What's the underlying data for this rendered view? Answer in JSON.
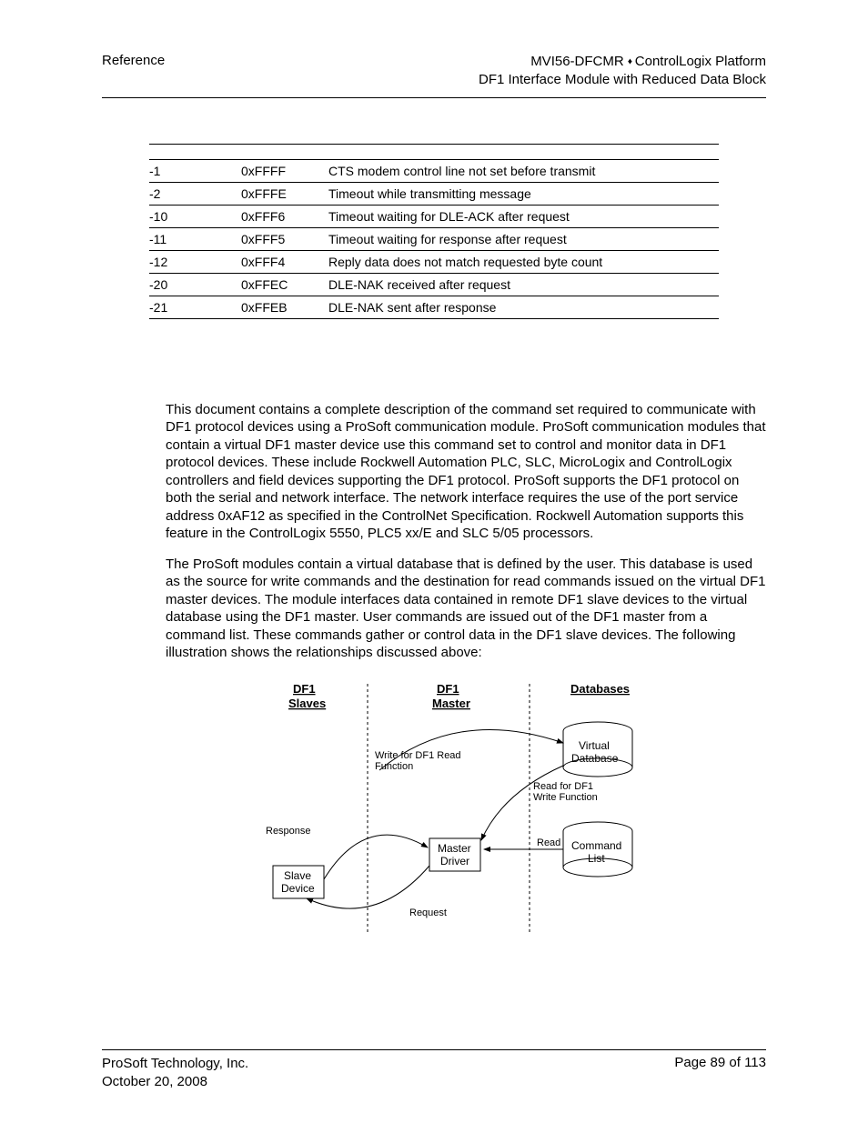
{
  "header": {
    "left": "Reference",
    "right_line1_a": "MVI56-DFCMR",
    "right_line1_b": "ControlLogix Platform",
    "right_line2": "DF1 Interface Module with Reduced Data Block"
  },
  "error_table": [
    {
      "dec": "-1",
      "hex": "0xFFFF",
      "desc": "CTS modem control line not set before transmit"
    },
    {
      "dec": "-2",
      "hex": "0xFFFE",
      "desc": "Timeout while transmitting message"
    },
    {
      "dec": "-10",
      "hex": "0xFFF6",
      "desc": "Timeout waiting for DLE-ACK after request"
    },
    {
      "dec": "-11",
      "hex": "0xFFF5",
      "desc": "Timeout waiting for response after request"
    },
    {
      "dec": "-12",
      "hex": "0xFFF4",
      "desc": "Reply data does not match requested byte count"
    },
    {
      "dec": "-20",
      "hex": "0xFFEC",
      "desc": "DLE-NAK received after request"
    },
    {
      "dec": "-21",
      "hex": "0xFFEB",
      "desc": "DLE-NAK sent after response"
    }
  ],
  "paragraphs": {
    "p1": "This document contains a complete description of the command set required to communicate with DF1 protocol devices using a ProSoft communication module. ProSoft communication modules that contain a virtual DF1 master device use this command set to control and monitor data in DF1 protocol devices. These include Rockwell Automation PLC, SLC, MicroLogix and ControlLogix controllers and field devices supporting the DF1 protocol. ProSoft supports the DF1 protocol on both the serial and network interface. The network interface requires the use of the port service address 0xAF12 as specified in the ControlNet Specification. Rockwell Automation supports this feature in the ControlLogix 5550, PLC5 xx/E and SLC 5/05 processors.",
    "p2": "The ProSoft modules contain a virtual database that is defined by the user. This database is used as the source for write commands and the destination for read commands issued on the virtual DF1 master devices. The module interfaces data contained in remote DF1 slave devices to the virtual database using the DF1 master. User commands are issued out of the DF1 master from a command list. These commands gather or control data in the DF1 slave devices. The following illustration shows the relationships discussed above:"
  },
  "diagram": {
    "col1_title1": "DF1",
    "col1_title2": "Slaves",
    "col2_title1": "DF1",
    "col2_title2": "Master",
    "col3_title": "Databases",
    "write_label1": "Write for DF1 Read",
    "write_label2": "Function",
    "read_label1": "Read for DF1",
    "read_label2": "Write Function",
    "response": "Response",
    "request": "Request",
    "read": "Read",
    "slave_device1": "Slave",
    "slave_device2": "Device",
    "master_driver1": "Master",
    "master_driver2": "Driver",
    "virtual_db1": "Virtual",
    "virtual_db2": "Database",
    "command_list1": "Command",
    "command_list2": "List"
  },
  "footer": {
    "company": "ProSoft Technology, Inc.",
    "date": "October 20, 2008",
    "page": "Page 89 of 113"
  }
}
